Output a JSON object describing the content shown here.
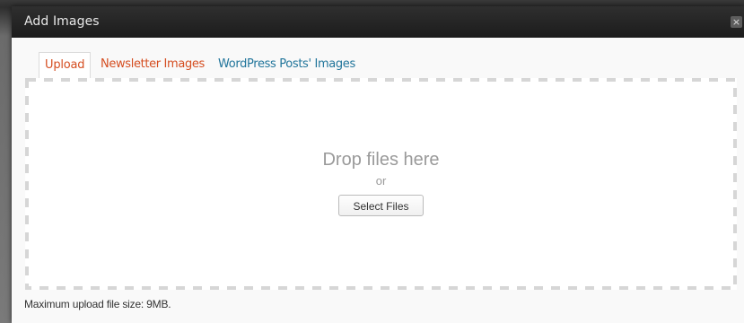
{
  "dialog": {
    "title": "Add Images",
    "close_label": "×"
  },
  "tabs": [
    {
      "label": "Upload",
      "active": true
    },
    {
      "label": "Newsletter Images",
      "active": false
    },
    {
      "label": "WordPress Posts' Images",
      "active": false
    }
  ],
  "dropzone": {
    "heading": "Drop files here",
    "or_label": "or",
    "button_label": "Select Files"
  },
  "footer": {
    "max_size_text": "Maximum upload file size: 9MB."
  },
  "colors": {
    "accent_orange": "#d54e21",
    "link_blue": "#21759b",
    "titlebar": "#222222"
  }
}
